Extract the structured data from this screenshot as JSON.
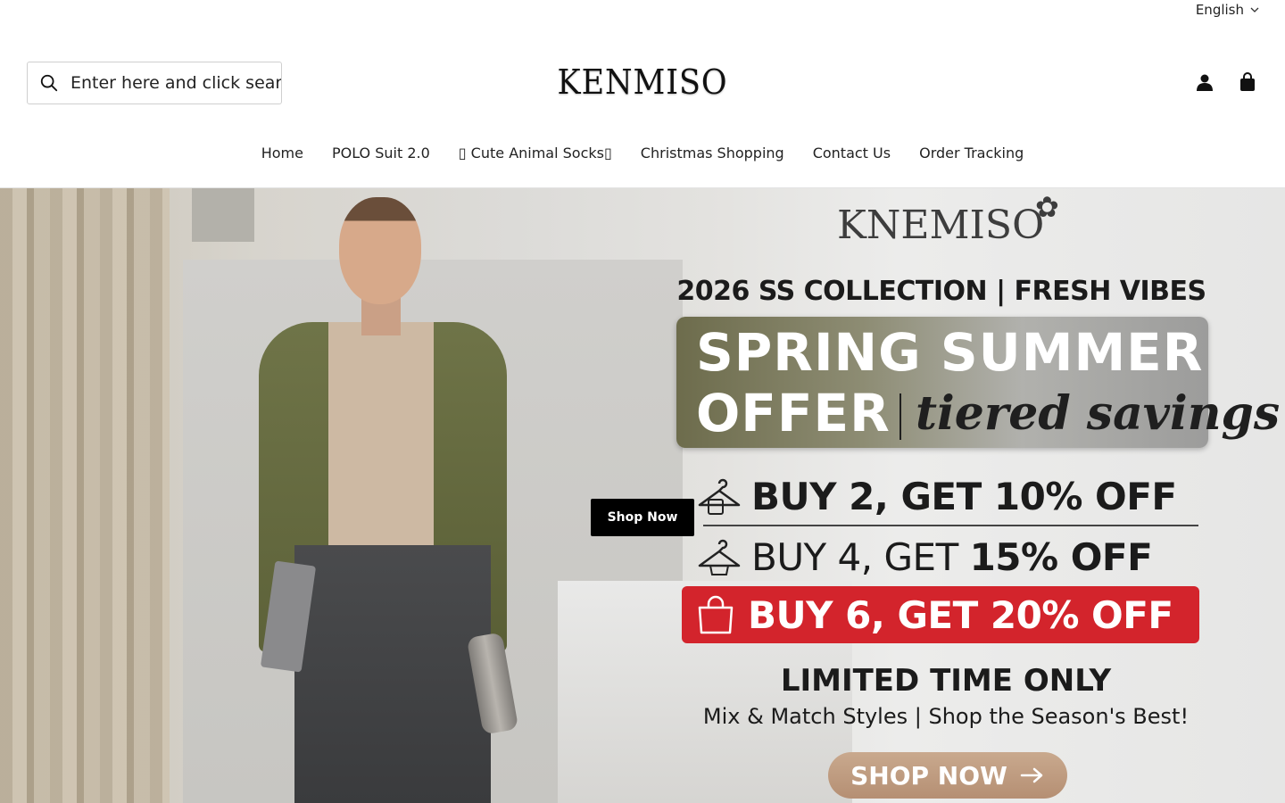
{
  "header": {
    "language": "English",
    "search_placeholder": "Enter here and click search",
    "logo_text": "KENMISO"
  },
  "nav": {
    "items": [
      "Home",
      "POLO Suit 2.0",
      "▯ Cute Animal Socks▯",
      "Christmas Shopping",
      "Contact Us",
      "Order Tracking"
    ]
  },
  "hero": {
    "shop_button": "Shop Now",
    "brand": "KNEMISO",
    "collection": "2026 SS COLLECTION | FRESH VIBES",
    "offer_line1": "SPRING SUMMER",
    "offer_line2": "OFFER",
    "offer_tagline": "tiered savings",
    "tier1": "BUY 2, GET 10% OFF",
    "tier2_prefix": "BUY 4, GET ",
    "tier2_bold": "15% OFF",
    "tier3": "BUY 6, GET 20% OFF",
    "limited": "LIMITED TIME ONLY",
    "mix": "Mix & Match Styles | Shop the Season's Best!",
    "shop_pill": "SHOP NOW"
  },
  "icons": {
    "search": "search-icon",
    "account": "user-icon",
    "cart": "bag-icon",
    "language_chevron": "chevron-down-icon"
  },
  "colors": {
    "accent_red": "#d3242c",
    "button_black": "#000000"
  }
}
